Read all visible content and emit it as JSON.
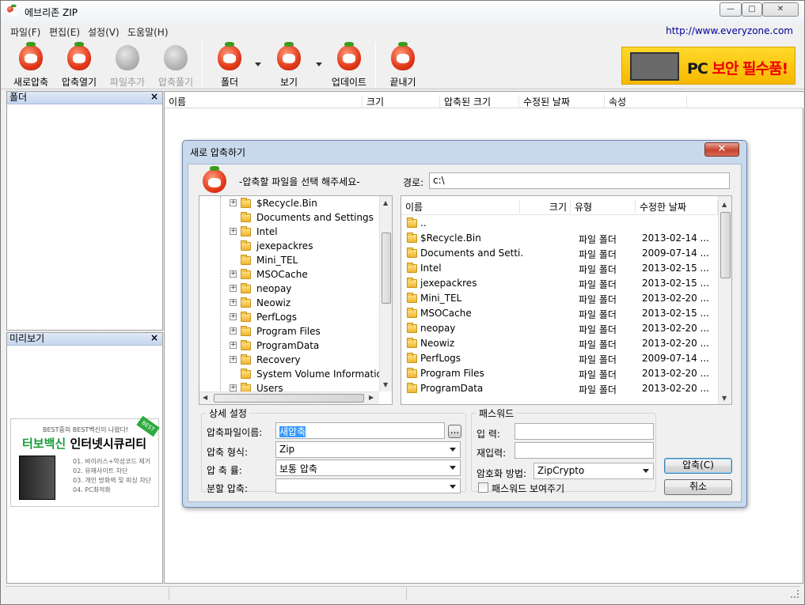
{
  "window": {
    "title": "에브리존 ZIP",
    "controls": {
      "minimize": "—",
      "maximize": "□",
      "close": "✕"
    }
  },
  "menu": {
    "items": [
      "파일(F)",
      "편집(E)",
      "설정(V)",
      "도움말(H)"
    ],
    "url": "http://www.everyzone.com"
  },
  "toolbar": {
    "buttons": [
      {
        "label": "새로압축",
        "icon": "tomato-new-icon",
        "enabled": true
      },
      {
        "label": "압축열기",
        "icon": "tomato-open-icon",
        "enabled": true
      },
      {
        "label": "파일추가",
        "icon": "tomato-add-icon",
        "enabled": false
      },
      {
        "label": "압축풀기",
        "icon": "tomato-extract-icon",
        "enabled": false
      },
      {
        "label": "폴더",
        "icon": "tomato-folder-icon",
        "enabled": true
      },
      {
        "label": "보기",
        "icon": "tomato-view-icon",
        "enabled": true
      },
      {
        "label": "업데이트",
        "icon": "tomato-update-icon",
        "enabled": true
      },
      {
        "label": "끝내기",
        "icon": "tomato-exit-icon",
        "enabled": true
      }
    ],
    "ad_text_black": "PC ",
    "ad_text_red": "보안 필수품!"
  },
  "left_panels": {
    "folder_title": "폴더",
    "preview_title": "미리보기",
    "close_glyph": "×",
    "side_ad": {
      "top": "BEST중의 BEST백신이 나왔다!",
      "headline_green": "터보백신",
      "headline_black": "인터넷시큐리티",
      "badge": "BEST",
      "features": [
        "01. 바이러스+악성코드 제거",
        "02. 유해사이트 차단",
        "03. 개인 방화벽 및 피싱 차단",
        "04. PC최적화"
      ]
    }
  },
  "file_list": {
    "columns": [
      "이름",
      "크기",
      "압축된 크기",
      "수정된 날짜",
      "속성"
    ]
  },
  "dialog": {
    "title": "새로 압축하기",
    "close": "✕",
    "prompt": "-압축할 파일을 선택 해주세요-",
    "path_label": "경로:",
    "path_value": "c:\\",
    "tree": [
      {
        "name": "$Recycle.Bin",
        "expandable": true
      },
      {
        "name": "Documents and Settings",
        "expandable": false
      },
      {
        "name": "Intel",
        "expandable": true
      },
      {
        "name": "jexepackres",
        "expandable": false
      },
      {
        "name": "Mini_TEL",
        "expandable": false
      },
      {
        "name": "MSOCache",
        "expandable": true
      },
      {
        "name": "neopay",
        "expandable": true
      },
      {
        "name": "Neowiz",
        "expandable": true
      },
      {
        "name": "PerfLogs",
        "expandable": true
      },
      {
        "name": "Program Files",
        "expandable": true
      },
      {
        "name": "ProgramData",
        "expandable": true
      },
      {
        "name": "Recovery",
        "expandable": true
      },
      {
        "name": "System Volume Information",
        "expandable": false
      },
      {
        "name": "Users",
        "expandable": true
      }
    ],
    "file_columns": [
      "이름",
      "크기",
      "유형",
      "수정한 날짜"
    ],
    "files": [
      {
        "name": "..",
        "type": "",
        "date": ""
      },
      {
        "name": "$Recycle.Bin",
        "type": "파일 폴더",
        "date": "2013-02-14 ..."
      },
      {
        "name": "Documents and Setti...",
        "type": "파일 폴더",
        "date": "2009-07-14 ..."
      },
      {
        "name": "Intel",
        "type": "파일 폴더",
        "date": "2013-02-15 ..."
      },
      {
        "name": "jexepackres",
        "type": "파일 폴더",
        "date": "2013-02-15 ..."
      },
      {
        "name": "Mini_TEL",
        "type": "파일 폴더",
        "date": "2013-02-20 ..."
      },
      {
        "name": "MSOCache",
        "type": "파일 폴더",
        "date": "2013-02-15 ..."
      },
      {
        "name": "neopay",
        "type": "파일 폴더",
        "date": "2013-02-20 ..."
      },
      {
        "name": "Neowiz",
        "type": "파일 폴더",
        "date": "2013-02-20 ..."
      },
      {
        "name": "PerfLogs",
        "type": "파일 폴더",
        "date": "2009-07-14 ..."
      },
      {
        "name": "Program Files",
        "type": "파일 폴더",
        "date": "2013-02-20 ..."
      },
      {
        "name": "ProgramData",
        "type": "파일 폴더",
        "date": "2013-02-20 ..."
      }
    ],
    "detail": {
      "title": "상세 설정",
      "name_label": "압축파일이름:",
      "name_value": "새압축",
      "browse": "...",
      "format_label": "압축 형식:",
      "format_value": "Zip",
      "level_label": "압 축 률:",
      "level_value": "보통 압축",
      "split_label": "분할 압축:",
      "split_value": ""
    },
    "password": {
      "title": "패스워드",
      "input_label": "입    력:",
      "confirm_label": "재입력:",
      "method_label": "암호화 방법:",
      "method_value": "ZipCrypto",
      "show_label": "패스워드 보여주기"
    },
    "ok": "압축(C)",
    "cancel": "취소"
  }
}
